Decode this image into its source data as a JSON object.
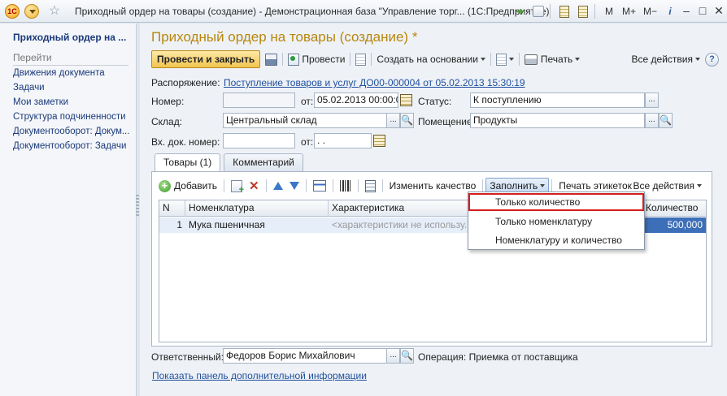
{
  "window": {
    "logo_text": "1С",
    "title": "Приходный ордер на товары (создание) - Демонстрационная база \"Управление торг...  (1С:Предприятие)",
    "m_label": "M",
    "m_plus_label": "M+",
    "m_minus_label": "M−",
    "info_label": "i",
    "minimize_label": "–",
    "maximize_label": "□",
    "close_label": "✕"
  },
  "sidebar": {
    "header": "Приходный ордер на ...",
    "goto_label": "Перейти",
    "items": [
      {
        "label": "Движения документа"
      },
      {
        "label": "Задачи"
      },
      {
        "label": "Мои заметки"
      },
      {
        "label": "Структура подчиненности"
      },
      {
        "label": "Документооборот: Докум..."
      },
      {
        "label": "Документооборот: Задачи"
      }
    ]
  },
  "document": {
    "title": "Приходный ордер на товары (создание) *"
  },
  "commandbar": {
    "post_and_close": "Провести и закрыть",
    "post": "Провести",
    "create_based_on": "Создать на основании",
    "print": "Печать",
    "all_actions": "Все действия",
    "help": "?"
  },
  "form": {
    "order_label": "Распоряжение:",
    "order_link": "Поступление товаров и услуг ДО00-000004 от 05.02.2013 15:30:19",
    "number_label": "Номер:",
    "number_value": "",
    "date_label": "от:",
    "date_value": "05.02.2013 00:00:00",
    "status_label": "Статус:",
    "status_value": "К поступлению",
    "warehouse_label": "Склад:",
    "warehouse_value": "Центральный склад",
    "room_label": "Помещение:",
    "room_value": "Продукты",
    "incoming_num_label": "Вх. док. номер:",
    "incoming_num_value": "",
    "incoming_date_label": "от:",
    "incoming_date_value": " .  .",
    "ellipsis": "...",
    "magnifier": "🔍"
  },
  "tabs": [
    {
      "label": "Товары (1)"
    },
    {
      "label": "Комментарий"
    }
  ],
  "table_toolbar": {
    "add": "Добавить",
    "change_quality": "Изменить качество",
    "fill": "Заполнить",
    "print_labels": "Печать этикеток",
    "all_actions": "Все действия"
  },
  "table": {
    "columns": [
      "N",
      "Номенклатура",
      "Характеристика",
      "Количество"
    ],
    "rows": [
      {
        "n": "1",
        "item": "Мука пшеничная",
        "characteristic": "<характеристики не использу...",
        "quantity": "500,000"
      }
    ]
  },
  "fill_menu": {
    "items": [
      {
        "label": "Только количество"
      },
      {
        "label": "Только номенклатуру"
      },
      {
        "label": "Номенклатуру и количество"
      }
    ]
  },
  "footer": {
    "responsible_label": "Ответственный:",
    "responsible_value": "Федоров Борис Михайлович",
    "operation_label": "Операция:",
    "operation_value": "Приемка от поставщика",
    "extra_info_link": "Показать панель дополнительной информации"
  }
}
